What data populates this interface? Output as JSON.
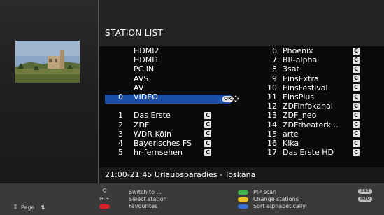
{
  "title": "STATION LIST",
  "colors": {
    "highlight": "#1b4fa8",
    "green": "#3fb14a",
    "yellow": "#e8c21a",
    "blue": "#3b6ed4",
    "red": "#d8222a"
  },
  "left_column": [
    {
      "num": "",
      "name": "HDMI2",
      "badge": ""
    },
    {
      "num": "",
      "name": "HDMI1",
      "badge": ""
    },
    {
      "num": "",
      "name": "PC IN",
      "badge": ""
    },
    {
      "num": "",
      "name": "AVS",
      "badge": ""
    },
    {
      "num": "",
      "name": "AV",
      "badge": ""
    },
    {
      "num": "0",
      "name": "VIDEO",
      "badge": "",
      "selected": true
    },
    {
      "num": "",
      "name": "",
      "badge": ""
    },
    {
      "num": "1",
      "name": "Das Erste",
      "badge": "C"
    },
    {
      "num": "2",
      "name": "ZDF",
      "badge": "C"
    },
    {
      "num": "3",
      "name": "WDR Köln",
      "badge": "C"
    },
    {
      "num": "4",
      "name": "Bayerisches FS",
      "badge": "C"
    },
    {
      "num": "5",
      "name": "hr-fernsehen",
      "badge": "C"
    }
  ],
  "right_column": [
    {
      "num": "6",
      "name": "Phoenix",
      "badge": "C"
    },
    {
      "num": "7",
      "name": "BR-alpha",
      "badge": "C"
    },
    {
      "num": "8",
      "name": "3sat",
      "badge": "C"
    },
    {
      "num": "9",
      "name": "EinsExtra",
      "badge": "C"
    },
    {
      "num": "10",
      "name": "EinsFestival",
      "badge": "C"
    },
    {
      "num": "11",
      "name": "EinsPlus",
      "badge": "C"
    },
    {
      "num": "12",
      "name": "ZDFinfokanal",
      "badge": "C"
    },
    {
      "num": "13",
      "name": "ZDF_neo",
      "badge": "C"
    },
    {
      "num": "14",
      "name": "ZDFtheaterk...",
      "badge": "C"
    },
    {
      "num": "15",
      "name": "arte",
      "badge": "C"
    },
    {
      "num": "16",
      "name": "Kika",
      "badge": "C"
    },
    {
      "num": "17",
      "name": "Das Erste HD",
      "badge": "C"
    }
  ],
  "ok_label": "OK",
  "program": "21:00-21:45 Urlaubsparadies - Toskana",
  "footer": {
    "page_label": "Page",
    "switch_to": "Switch to ...",
    "select_station": "Select station",
    "favourites": "Favourites",
    "pip_scan": "PIP scan",
    "change_stations": "Change stations",
    "sort_alpha": "Sort alphabetically",
    "end_label": "END",
    "info_label": "INFO"
  }
}
